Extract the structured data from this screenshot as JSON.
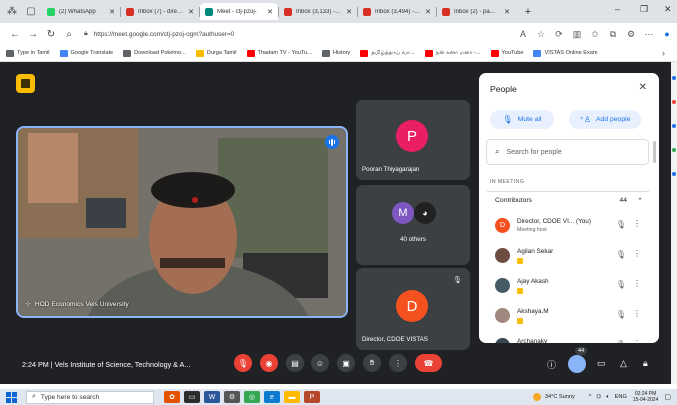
{
  "browser": {
    "tabs": [
      {
        "label": "(2) WhatsApp",
        "color": "#25d366",
        "active": false
      },
      {
        "label": "Inbox (7) - director.c",
        "color": "#d93025",
        "active": false
      },
      {
        "label": "Meet - ctj-pzoj-",
        "color": "#00897b",
        "active": true
      },
      {
        "label": "Inbox (3,133) - pams",
        "color": "#d93025",
        "active": false
      },
      {
        "label": "Inbox (3,494) - drdus",
        "color": "#d93025",
        "active": false
      },
      {
        "label": "Inbox (2) - pams197",
        "color": "#d93025",
        "active": false
      }
    ],
    "new_tab": "+",
    "url": "https://meet.google.com/ctj-pzoj-ogm?authuser=0",
    "bookmarks": [
      {
        "label": "Type in Tamil",
        "color": "#5f6368"
      },
      {
        "label": "Google Translate",
        "color": "#4285f4"
      },
      {
        "label": "Download Pokémo...",
        "color": "#5f6368"
      },
      {
        "label": "Durga Tamil",
        "color": "#fbbc04"
      },
      {
        "label": "Thadam TV - YouTu...",
        "color": "#ff0000"
      },
      {
        "label": "History",
        "color": "#5f6368"
      },
      {
        "label": "தமிழ்த்தாய் வா...",
        "color": "#ff0000"
      },
      {
        "label": "நன் கனா மனா -...",
        "color": "#ff0000"
      },
      {
        "label": "YouTube",
        "color": "#ff0000"
      },
      {
        "label": "VISTAS Online Exam",
        "color": "#4285f4"
      }
    ]
  },
  "meet": {
    "main_speaker": {
      "name": "HOD Economics Vels University"
    },
    "tiles": [
      {
        "avatar_letter": "P",
        "avatar_color": "#e91e63",
        "name": "Pooran Thiyagarajan"
      },
      {
        "avatar_letter": "M",
        "avatar_color": "#7e57c2",
        "name": "40 others"
      },
      {
        "avatar_letter": "D",
        "avatar_color": "#f4511e",
        "name": "Director, CDOE VISTAS"
      }
    ],
    "people_panel": {
      "title": "People",
      "mute_all": "Mute all",
      "add_people": "Add people",
      "search_placeholder": "Search for people",
      "section": "IN MEETING",
      "group": "Contributors",
      "count": "44",
      "participants": [
        {
          "name": "Director, CDOE VI...  (You)",
          "sub": "Meeting host",
          "avatar": "D",
          "color": "#f4511e"
        },
        {
          "name": "Agilan Sekar",
          "sub": "",
          "avatar": "",
          "color": "#6d4c41"
        },
        {
          "name": "Ajay Akash",
          "sub": "",
          "avatar": "",
          "color": "#455a64"
        },
        {
          "name": "Akshaya.M",
          "sub": "",
          "avatar": "",
          "color": "#a1887f"
        },
        {
          "name": "Archanaky",
          "sub": "",
          "avatar": "",
          "color": "#37474f"
        }
      ]
    },
    "bottom_bar": {
      "time_title": "2:24 PM  |  Vels Institute of Science, Technology & A...",
      "participant_badge": "44"
    }
  },
  "taskbar": {
    "search_placeholder": "Type here to search",
    "weather": "34°C  Sunny",
    "lang": "ENG",
    "time": "02:24 PM",
    "date": "15-04-2024"
  }
}
